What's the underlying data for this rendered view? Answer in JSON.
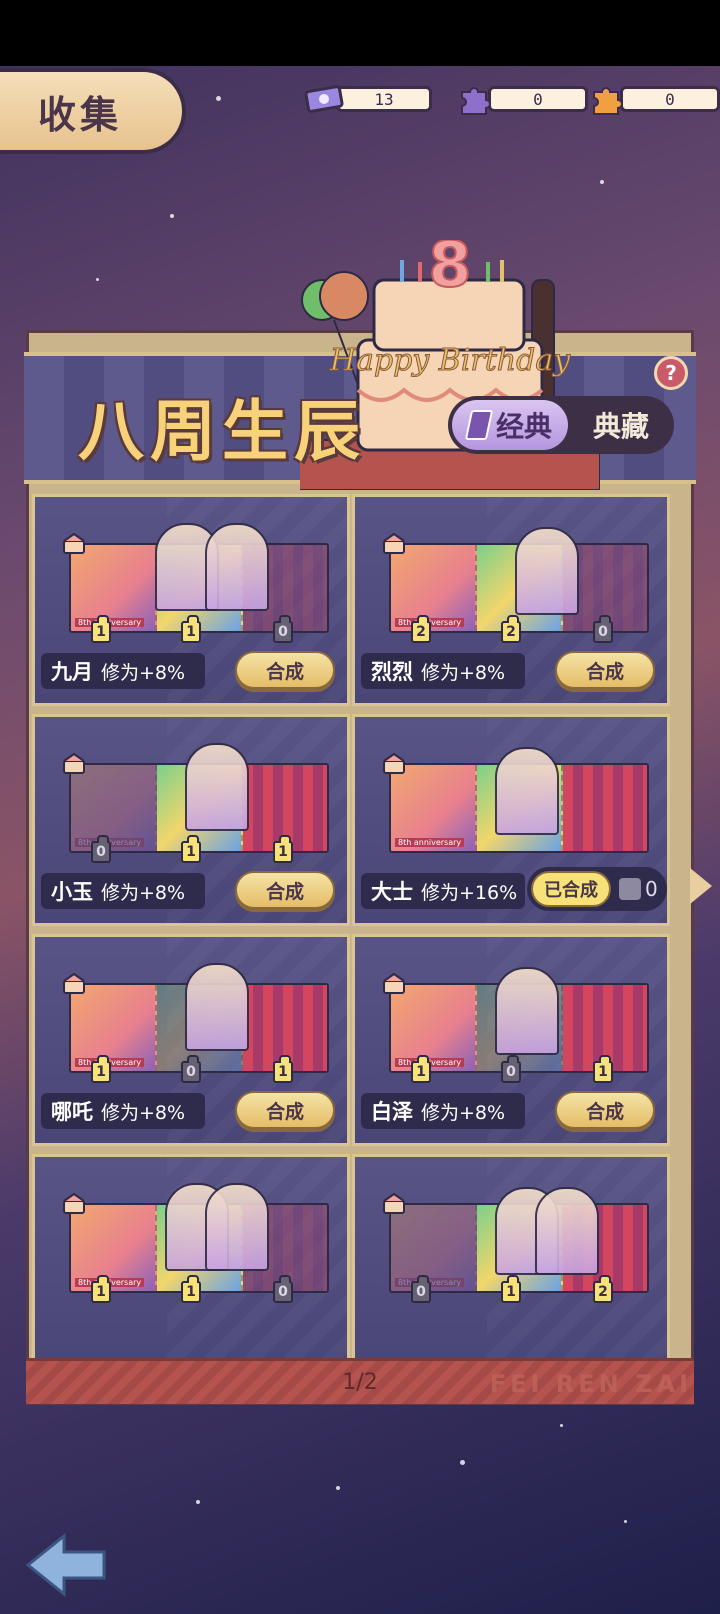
{
  "header": {
    "tab_title": "收集",
    "currencies": [
      {
        "icon": "ticket-icon",
        "value": "13"
      },
      {
        "icon": "purple-puzzle-icon",
        "value": "0"
      },
      {
        "icon": "orange-puzzle-icon",
        "value": "0"
      }
    ]
  },
  "banner": {
    "title": "八周生辰",
    "cake_number": "8",
    "cake_text": "Happy Birthday",
    "mode_active": "经典",
    "mode_inactive": "典藏",
    "help_label": "?"
  },
  "cards": [
    {
      "name": "九月",
      "bonus": "修为+8%",
      "counts": [
        "1",
        "1",
        "0"
      ],
      "state": "合成",
      "anniv": "8th anniversary"
    },
    {
      "name": "烈烈",
      "bonus": "修为+8%",
      "counts": [
        "2",
        "2",
        "0"
      ],
      "state": "合成",
      "anniv": "8th anniversary"
    },
    {
      "name": "小玉",
      "bonus": "修为+8%",
      "counts": [
        "0",
        "1",
        "1"
      ],
      "state": "合成",
      "anniv": "8th anniversary"
    },
    {
      "name": "大士",
      "bonus": "修为+16%",
      "counts": [],
      "state": "已合成",
      "puzzle_count": "0",
      "anniv": "8th anniversary"
    },
    {
      "name": "哪吒",
      "bonus": "修为+8%",
      "counts": [
        "1",
        "0",
        "1"
      ],
      "state": "合成",
      "anniv": "8th anniversary"
    },
    {
      "name": "白泽",
      "bonus": "修为+8%",
      "counts": [
        "1",
        "0",
        "1"
      ],
      "state": "合成",
      "anniv": "8th anniversary"
    },
    {
      "name": "",
      "bonus": "",
      "counts": [
        "1",
        "1",
        "0"
      ],
      "state": "",
      "anniv": "8th anniversary"
    },
    {
      "name": "",
      "bonus": "",
      "counts": [
        "0",
        "1",
        "2"
      ],
      "state": "",
      "anniv": "8th anniversary"
    }
  ],
  "pager": {
    "label": "1/2",
    "watermark": "FEI REN ZAI"
  },
  "colors": {
    "accent_gold": "#f7d27a",
    "panel_purple": "#585486",
    "button_gold": "#e5bd68"
  }
}
